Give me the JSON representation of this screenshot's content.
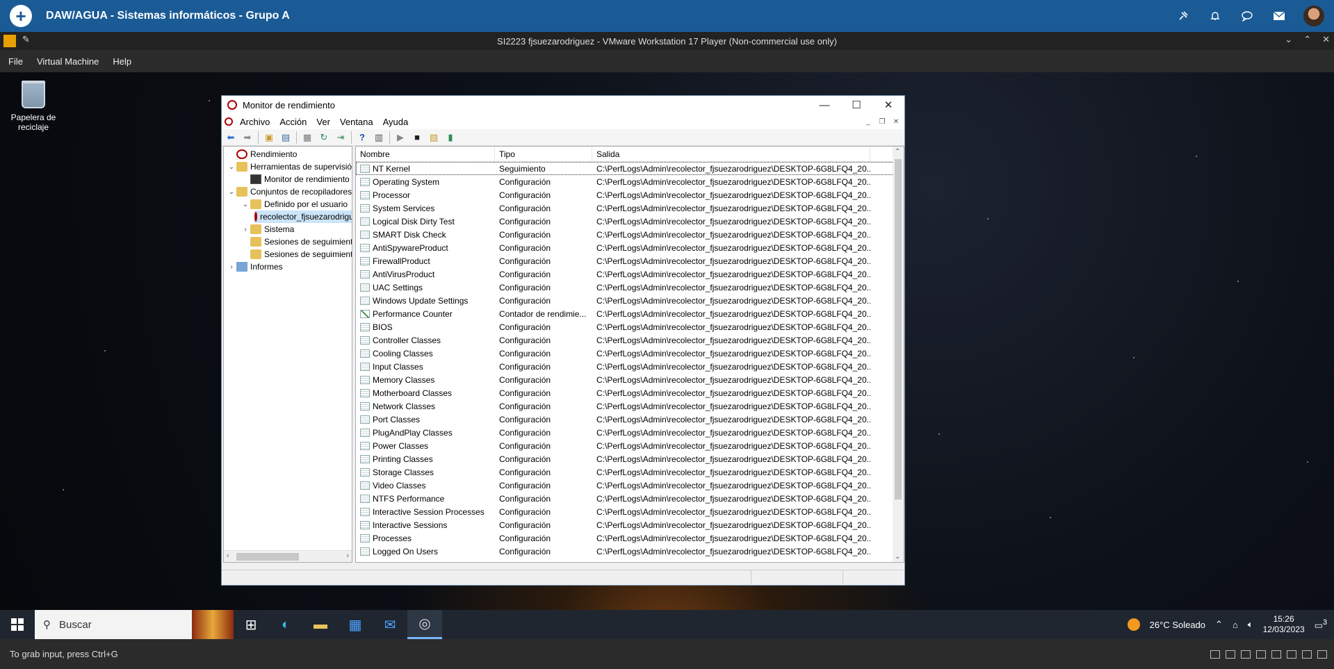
{
  "host": {
    "title": "DAW/AGUA - Sistemas informáticos - Grupo A",
    "icons": [
      "pin-icon",
      "bell-icon",
      "chat-icon",
      "mail-icon",
      "avatar"
    ]
  },
  "vm": {
    "title": "SI2223 fjsuezarodriguez - VMware Workstation 17 Player (Non-commercial use only)",
    "menu": [
      "File",
      "Virtual Machine",
      "Help"
    ],
    "status": "To grab input, press Ctrl+G"
  },
  "desktop": {
    "recycle_label": "Papelera de reciclaje"
  },
  "window": {
    "title": "Monitor de rendimiento",
    "menu": [
      "Archivo",
      "Acción",
      "Ver",
      "Ventana",
      "Ayuda"
    ],
    "tree": [
      {
        "label": "Rendimiento",
        "level": 0,
        "icon": "perf",
        "exp": ""
      },
      {
        "label": "Herramientas de supervisión",
        "level": 1,
        "icon": "folder",
        "exp": "⌄"
      },
      {
        "label": "Monitor de rendimiento",
        "level": 2,
        "icon": "mon",
        "exp": ""
      },
      {
        "label": "Conjuntos de recopiladores de datos",
        "level": 1,
        "icon": "folder",
        "exp": "⌄"
      },
      {
        "label": "Definido por el usuario",
        "level": 2,
        "icon": "folder",
        "exp": "⌄"
      },
      {
        "label": "recolector_fjsuezarodriguez",
        "level": 3,
        "icon": "perf",
        "exp": "",
        "selected": true
      },
      {
        "label": "Sistema",
        "level": 2,
        "icon": "folder",
        "exp": "›"
      },
      {
        "label": "Sesiones de seguimiento de eventos",
        "level": 2,
        "icon": "folder",
        "exp": ""
      },
      {
        "label": "Sesiones de seguimiento de eventos de inicio",
        "level": 2,
        "icon": "folder",
        "exp": ""
      },
      {
        "label": "Informes",
        "level": 1,
        "icon": "book",
        "exp": "›"
      }
    ],
    "columns": [
      "Nombre",
      "Tipo",
      "Salida"
    ],
    "output_path": "C:\\PerfLogs\\Admin\\recolector_fjsuezarodriguez\\DESKTOP-6G8LFQ4_20...",
    "rows": [
      {
        "name": "NT Kernel",
        "type": "Seguimiento",
        "icon": "table"
      },
      {
        "name": "Operating System",
        "type": "Configuración",
        "icon": "table"
      },
      {
        "name": "Processor",
        "type": "Configuración",
        "icon": "table"
      },
      {
        "name": "System Services",
        "type": "Configuración",
        "icon": "table"
      },
      {
        "name": "Logical Disk Dirty Test",
        "type": "Configuración",
        "icon": "table"
      },
      {
        "name": "SMART Disk Check",
        "type": "Configuración",
        "icon": "table"
      },
      {
        "name": "AntiSpywareProduct",
        "type": "Configuración",
        "icon": "table"
      },
      {
        "name": "FirewallProduct",
        "type": "Configuración",
        "icon": "table"
      },
      {
        "name": "AntiVirusProduct",
        "type": "Configuración",
        "icon": "table"
      },
      {
        "name": "UAC Settings",
        "type": "Configuración",
        "icon": "table"
      },
      {
        "name": "Windows Update Settings",
        "type": "Configuración",
        "icon": "table"
      },
      {
        "name": "Performance Counter",
        "type": "Contador de rendimie...",
        "icon": "chart"
      },
      {
        "name": "BIOS",
        "type": "Configuración",
        "icon": "table"
      },
      {
        "name": "Controller Classes",
        "type": "Configuración",
        "icon": "table"
      },
      {
        "name": "Cooling Classes",
        "type": "Configuración",
        "icon": "table"
      },
      {
        "name": "Input Classes",
        "type": "Configuración",
        "icon": "table"
      },
      {
        "name": "Memory Classes",
        "type": "Configuración",
        "icon": "table"
      },
      {
        "name": "Motherboard Classes",
        "type": "Configuración",
        "icon": "table"
      },
      {
        "name": "Network Classes",
        "type": "Configuración",
        "icon": "table"
      },
      {
        "name": "Port Classes",
        "type": "Configuración",
        "icon": "table"
      },
      {
        "name": "PlugAndPlay Classes",
        "type": "Configuración",
        "icon": "table"
      },
      {
        "name": "Power Classes",
        "type": "Configuración",
        "icon": "table"
      },
      {
        "name": "Printing Classes",
        "type": "Configuración",
        "icon": "table"
      },
      {
        "name": "Storage Classes",
        "type": "Configuración",
        "icon": "table"
      },
      {
        "name": "Video Classes",
        "type": "Configuración",
        "icon": "table"
      },
      {
        "name": "NTFS Performance",
        "type": "Configuración",
        "icon": "table"
      },
      {
        "name": "Interactive Session Processes",
        "type": "Configuración",
        "icon": "table"
      },
      {
        "name": "Interactive Sessions",
        "type": "Configuración",
        "icon": "table"
      },
      {
        "name": "Processes",
        "type": "Configuración",
        "icon": "table"
      },
      {
        "name": "Logged On Users",
        "type": "Configuración",
        "icon": "table"
      }
    ]
  },
  "taskbar": {
    "search_placeholder": "Buscar",
    "weather": "26°C  Soleado",
    "time": "15:26",
    "date": "12/03/2023",
    "notifications": "3"
  }
}
